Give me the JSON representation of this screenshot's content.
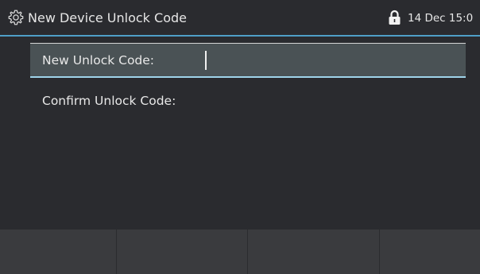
{
  "header": {
    "title": "New Device Unlock Code",
    "datetime": "14 Dec 15:0",
    "settings_icon": "gear-icon",
    "lock_icon": "lock-icon",
    "accent_color": "#4f9fc8"
  },
  "form": {
    "new_code_label": "New Unlock Code:",
    "new_code_value": "",
    "confirm_code_label": "Confirm Unlock Code:",
    "confirm_code_value": "",
    "focused_field": "new_code"
  },
  "softkeys": [
    {
      "label": ""
    },
    {
      "label": ""
    },
    {
      "label": ""
    },
    {
      "label": ""
    }
  ],
  "colors": {
    "background": "#2a2b2f",
    "selected_row": "#4a5255",
    "selected_underline": "#9fd4ea",
    "softkey_bar": "#3a3b3e"
  }
}
